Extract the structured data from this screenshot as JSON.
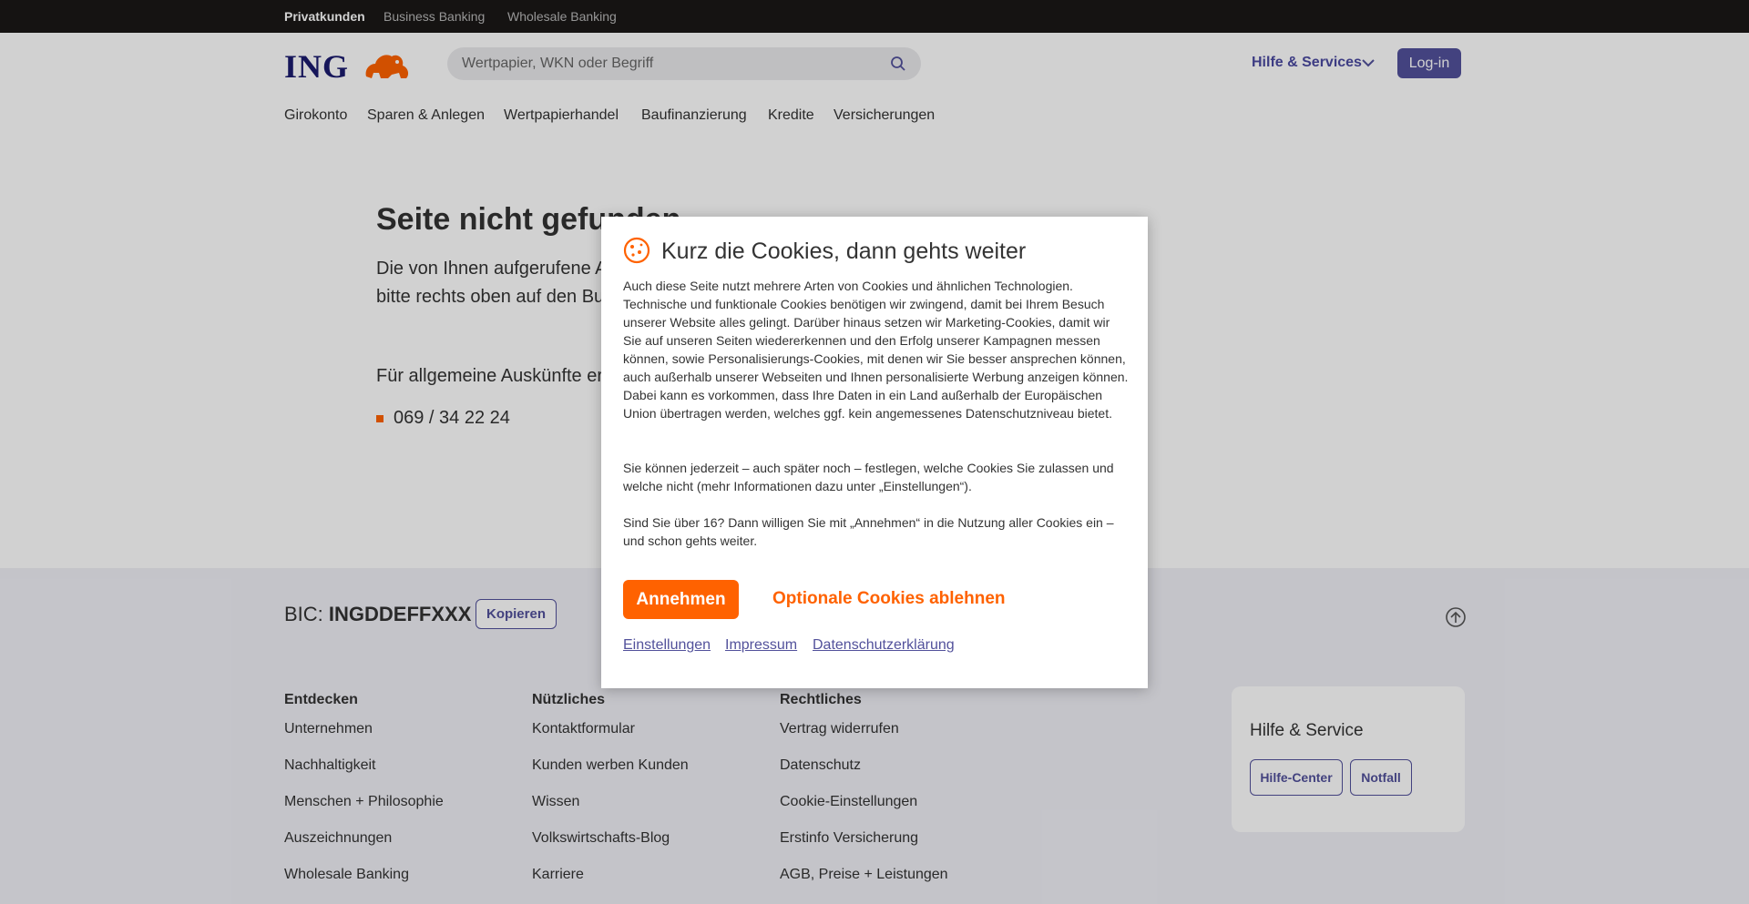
{
  "topbar": {
    "tabs": [
      {
        "label": "Privatkunden"
      },
      {
        "label": "Business Banking"
      },
      {
        "label": "Wholesale Banking"
      }
    ]
  },
  "header": {
    "logo_text": "ING",
    "search_placeholder": "Wertpapier, WKN oder Begriff",
    "hilfe_label": "Hilfe & Services",
    "login_label": "Log-in",
    "nav": [
      "Girokonto",
      "Sparen & Anlegen",
      "Wertpapierhandel",
      "Baufinanzierung",
      "Kredite",
      "Versicherungen"
    ]
  },
  "main": {
    "title": "Seite nicht gefunden",
    "text_line1": "Die von Ihnen aufgerufene A",
    "text_line2": "bitte rechts oben auf den Bu",
    "info": "Für allgemeine Auskünfte er",
    "phone": "069 / 34 22 24"
  },
  "footer": {
    "bic_label": "BIC:",
    "bic_value": "INGDDEFFXXX",
    "copy_label": "Kopieren",
    "columns": [
      {
        "title": "Entdecken",
        "items": [
          "Unternehmen",
          "Nachhaltigkeit",
          "Menschen + Philosophie",
          "Auszeichnungen",
          "Wholesale Banking"
        ]
      },
      {
        "title": "Nützliches",
        "items": [
          "Kontaktformular",
          "Kunden werben Kunden",
          "Wissen",
          "Volkswirtschafts-Blog",
          "Karriere"
        ]
      },
      {
        "title": "Rechtliches",
        "items": [
          "Vertrag widerrufen",
          "Datenschutz",
          "Cookie-Einstellungen",
          "Erstinfo Versicherung",
          "AGB, Preise + Leistungen"
        ]
      }
    ],
    "help": {
      "title": "Hilfe & Service",
      "buttons": [
        "Hilfe-Center",
        "Notfall"
      ]
    }
  },
  "modal": {
    "title": "Kurz die Cookies, dann gehts weiter",
    "para1": "Auch diese Seite nutzt mehrere Arten von Cookies und ähnlichen Technologien. Technische und funktionale Cookies benötigen wir zwingend, damit bei Ihrem Besuch unserer Website alles gelingt. Darüber hinaus setzen wir Marketing-Cookies, damit wir Sie auf unseren Seiten wiedererkennen und den Erfolg unserer Kampagnen messen können, sowie Personalisierungs-Cookies, mit denen wir Sie besser ansprechen können, auch außerhalb unserer Webseiten und Ihnen personalisierte Werbung anzeigen können. Dabei kann es vorkommen, dass Ihre Daten in ein Land außerhalb der Europäischen Union übertragen werden, welches ggf. kein angemessenes Datenschutzniveau bietet.",
    "para2": "Sie können jederzeit – auch später noch – festlegen, welche Cookies Sie zulassen und welche nicht (mehr Informationen dazu unter „Einstellungen“).",
    "para3": "Sind Sie über 16? Dann willigen Sie mit „Annehmen“ in die Nutzung aller Cookies ein – und schon gehts weiter.",
    "accept_label": "Annehmen",
    "decline_label": "Optionale Cookies ablehnen",
    "links": [
      "Einstellungen",
      "Impressum",
      "Datenschutzerklärung"
    ]
  },
  "colors": {
    "brand_orange": "#ff6200",
    "brand_indigo": "#52519b",
    "logo_navy": "#1c1b6e"
  }
}
